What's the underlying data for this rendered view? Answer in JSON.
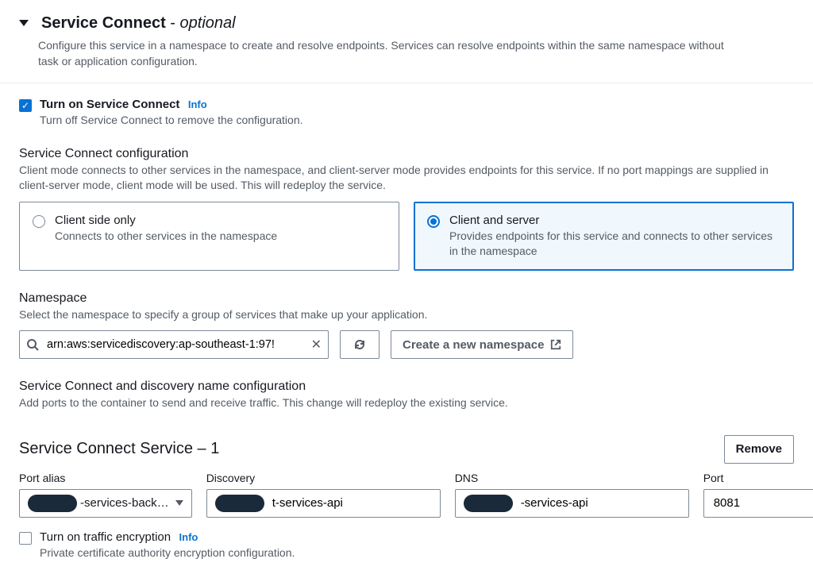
{
  "header": {
    "title_main": "Service Connect",
    "title_dash": " - ",
    "title_optional": "optional",
    "desc": "Configure this service in a namespace to create and resolve endpoints. Services can resolve endpoints within the same namespace without task or application configuration."
  },
  "turn_on": {
    "checked": true,
    "label": "Turn on Service Connect",
    "info": "Info",
    "hint": "Turn off Service Connect to remove the configuration."
  },
  "config": {
    "title": "Service Connect configuration",
    "desc": "Client mode connects to other services in the namespace, and client-server mode provides endpoints for this service. If no port mappings are supplied in client-server mode, client mode will be used. This will redeploy the service.",
    "options": [
      {
        "title": "Client side only",
        "desc": "Connects to other services in the namespace",
        "selected": false
      },
      {
        "title": "Client and server",
        "desc": "Provides endpoints for this service and connects to other services in the namespace",
        "selected": true
      }
    ]
  },
  "namespace": {
    "title": "Namespace",
    "desc": "Select the namespace to specify a group of services that make up your application.",
    "value": "arn:aws:servicediscovery:ap-southeast-1:97!",
    "create_label": "Create a new namespace"
  },
  "name_config": {
    "title": "Service Connect and discovery name configuration",
    "desc": "Add ports to the container to send and receive traffic. This change will redeploy the existing service."
  },
  "svc": {
    "title": "Service Connect Service – 1",
    "remove": "Remove",
    "fields": {
      "port_alias": {
        "label": "Port alias",
        "value": "-services-back…"
      },
      "discovery": {
        "label": "Discovery",
        "value": "t-services-api"
      },
      "dns": {
        "label": "DNS",
        "value": "-services-api"
      },
      "port": {
        "label": "Port",
        "value": "8081"
      }
    }
  },
  "traffic": {
    "checked": false,
    "label": "Turn on traffic encryption",
    "info": "Info",
    "hint": "Private certificate authority encryption configuration."
  }
}
